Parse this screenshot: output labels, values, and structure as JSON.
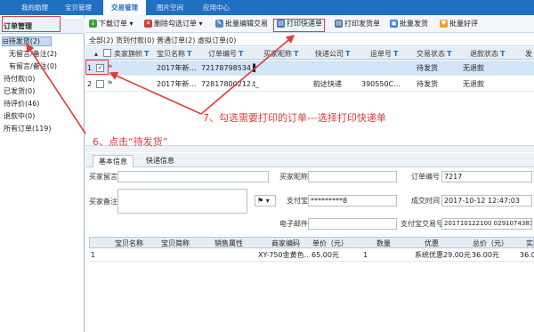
{
  "topnav": {
    "tabs": [
      {
        "label": "我的助理"
      },
      {
        "label": "宝贝管理"
      },
      {
        "label": "交易管理"
      },
      {
        "label": "图片空间"
      },
      {
        "label": "应用中心"
      }
    ],
    "active_tab": "交易管理"
  },
  "sidebar": {
    "title": "订单管理",
    "items": [
      {
        "label": "待发货(2)"
      },
      {
        "label": "无留言/备注(2)"
      },
      {
        "label": "有留言/备注(0)"
      },
      {
        "label": "待付款(0)"
      },
      {
        "label": "已发货(0)"
      },
      {
        "label": "待评价(46)"
      },
      {
        "label": "退款中(0)"
      },
      {
        "label": "所有订单(119)"
      }
    ]
  },
  "toolbar": {
    "download": "下载订单",
    "delete": "删除勾选订单",
    "batch_edit": "批量编辑交易",
    "print_express": "打印快递单",
    "print_invoice": "打印发货单",
    "batch_ship": "批量发货",
    "batch_review": "批量好评"
  },
  "filter_tabs": [
    {
      "label": "全部(2)"
    },
    {
      "label": "货到付款(0)"
    },
    {
      "label": "普通订单(2)"
    },
    {
      "label": "虚拟订单(0)"
    }
  ],
  "grid": {
    "columns": [
      "卖家旗帜",
      "宝贝名称",
      "订单编号",
      "买家昵称",
      "快递公司",
      "运单号",
      "交易状态",
      "退款状态",
      "发"
    ],
    "rows": [
      {
        "num": "1",
        "checked": true,
        "name": "2017年新…",
        "order_no": "72178798534…",
        "buyer": "▌",
        "express": "",
        "waybill": "",
        "status": "待发货",
        "refund": "无退款"
      },
      {
        "num": "2",
        "checked": false,
        "name": "2017年新…",
        "order_no": "72817800212…",
        "buyer": "t_",
        "express": "韵达快递",
        "waybill": "390550C…",
        "status": "待发货",
        "refund": "无退款"
      }
    ]
  },
  "detail": {
    "tabs": [
      "基本信息",
      "快递信息"
    ],
    "labels": {
      "buyer_message": "买家留言",
      "buyer_nick": "买家昵称",
      "order_no": "订单编号",
      "seller_note": "买家备注",
      "alipay": "支付宝",
      "deal_time": "成交时间",
      "email": "电子邮件",
      "alipay_no": "支付宝交易号"
    },
    "values": {
      "order_no": "7217",
      "alipay": "*********8",
      "deal_time": "2017-10-12 12:47:03",
      "alipay_no": "201710122100       0291074381"
    },
    "flag_symbol": "⚑"
  },
  "items": {
    "columns": [
      "宝贝名称",
      "宝贝简称",
      "销售属性",
      "商家编码",
      "单价（元）",
      "数量",
      "优惠",
      "总价（元）",
      "实"
    ],
    "rows": [
      {
        "num": "1",
        "name": "",
        "short": "",
        "sku": "",
        "code": "XY-750金黄色…",
        "price": "65.00元",
        "qty": "1",
        "discount": "系统优惠29.00元",
        "total": "36.00元",
        "paid": "36.0"
      }
    ]
  },
  "annotations": {
    "step6": "6、点击“待发货”",
    "step7": "7、勾选需要打印的订单---选择打印快递单"
  },
  "colors": {
    "nav": "#1f6fc2",
    "annotation": "#e23b3b",
    "selected_row": "#d3e5f8"
  }
}
